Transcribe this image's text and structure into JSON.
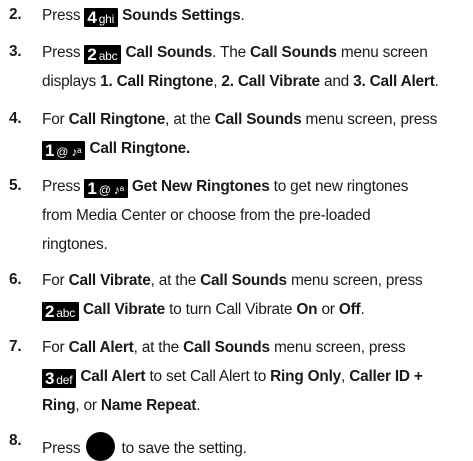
{
  "steps": [
    {
      "number": "2.",
      "t1": "Press",
      "key": {
        "digit": "4",
        "letters": "ghi"
      },
      "t2": "Sounds Settings",
      "t3": "."
    },
    {
      "number": "3.",
      "t1": "Press",
      "key": {
        "digit": "2",
        "letters": "abc"
      },
      "t2": "Call Sounds",
      "t3": ". The",
      "t4": "Call Sounds",
      "t5": "menu screen",
      "t6": "displays",
      "t7": "1. Call Ringtone",
      "t8": ",",
      "t9": "2. Call Vibrate",
      "t10": "and",
      "t11": "3. Call Alert",
      "t12": "."
    },
    {
      "number": "4.",
      "t1": "For",
      "t2": "Call Ringtone",
      "t3": ", at the",
      "t4": "Call Sounds",
      "t5": "menu screen, press",
      "key": {
        "digit": "1",
        "letters": "@ ♪ᵃ"
      },
      "t6": "Call Ringtone."
    },
    {
      "number": "5.",
      "t1": "Press",
      "key": {
        "digit": "1",
        "letters": "@ ♪ᵃ"
      },
      "t2": "Get New Ringtones",
      "t3": "to get new ringtones",
      "t4": "from Media Center or choose from the pre-loaded",
      "t5": "ringtones."
    },
    {
      "number": "6.",
      "t1": "For",
      "t2": "Call Vibrate",
      "t3": ", at the",
      "t4": "Call Sounds",
      "t5": "menu screen, press",
      "key": {
        "digit": "2",
        "letters": "abc"
      },
      "t6": "Call Vibrate",
      "t7": "to turn Call Vibrate",
      "t8": "On",
      "t9": "or",
      "t10": "Off",
      "t11": "."
    },
    {
      "number": "7.",
      "t1": "For",
      "t2": "Call Alert",
      "t3": ", at the",
      "t4": "Call Sounds",
      "t5": "menu screen, press",
      "key": {
        "digit": "3",
        "letters": "def"
      },
      "t6": "Call Alert",
      "t7": "to set Call Alert to",
      "t8": "Ring Only",
      "t9": ",",
      "t10": "Caller ID +",
      "t11": "Ring",
      "t12": ", or",
      "t13": "Name Repeat",
      "t14": "."
    },
    {
      "number": "8.",
      "t1": "Press",
      "button_icon": "ok-button-icon",
      "t2": "to save the setting."
    }
  ]
}
